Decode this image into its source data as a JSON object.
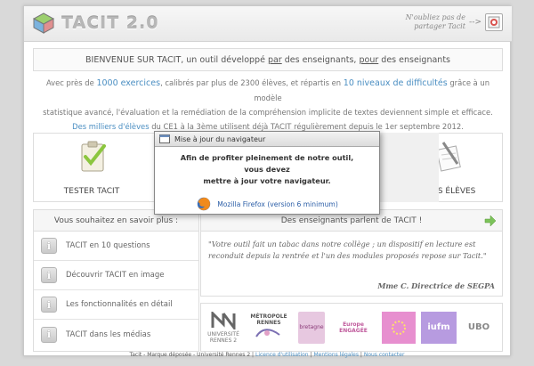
{
  "header": {
    "logo_text": "TACIT 2.0",
    "share_text_line1": "N'oubliez pas de",
    "share_text_line2": "partager Tacit",
    "share_arrow": "-->"
  },
  "welcome": {
    "part1": "BIENVENUE SUR TACIT, un outil développé ",
    "par": "par",
    "part2": " des enseignants, ",
    "pour": "pour",
    "part3": " des enseignants"
  },
  "intro": {
    "l1a": "Avec près de ",
    "l1b": "1000 exercices",
    "l1c": ", calibrés par plus de 2300 élèves, et répartis en ",
    "l1d": "10 niveaux de difficultés",
    "l1e": " grâce à un modèle",
    "l2": "statistique avancé, l'évaluation et la remédiation de la compréhension implicite de textes deviennent simple et efficace.",
    "l3a": "Des milliers d'élèves",
    "l3b": " du CE1 à la 3ème utilisent déjà TACIT régulièrement depuis le 1er septembre 2012."
  },
  "boxes": {
    "tester": "TESTER TACIT",
    "eleves": "ACCÈS ÉLÈVES"
  },
  "left_panel": {
    "title": "Vous souhaitez en savoir plus :",
    "items": [
      {
        "label": "TACIT en 10 questions"
      },
      {
        "label": "Découvrir TACIT en image"
      },
      {
        "label": "Les fonctionnalités en détail"
      },
      {
        "label": "TACIT dans les médias"
      }
    ]
  },
  "right_panel": {
    "title": "Des enseignants parlent de TACIT !",
    "quote": "\"Votre outil fait un tabac dans notre collège ; un dispositif en lecture est reconduit depuis la rentrée et l'un des modules proposés repose sur Tacit.\"",
    "author": "Mme C. Directrice de SEGPA"
  },
  "partners": {
    "p1": "UNIVERSITÉ RENNES 2",
    "p2": "MÉTROPOLE RENNES",
    "p3": "bretagne",
    "p4": "Europe ENGAGÉE",
    "p5": "",
    "p6": "iufm",
    "p7": "UBO"
  },
  "footer": {
    "prefix": "Tacit - Marque déposée - Université Rennes 2 | ",
    "licence": "Licence d'utilisation",
    "sep1": " | ",
    "mentions": "Mentions légales",
    "sep2": " | ",
    "contact": "Nous contacter"
  },
  "modal": {
    "title": "Mise à jour du navigateur",
    "line1": "Afin de profiter pleinement de notre outil, vous devez",
    "line2": "mettre à jour votre navigateur.",
    "link": "Mozilla Firefox (version 6 minimum)"
  },
  "colors": {
    "accent": "#4a8ec2",
    "arrow_green": "#7cc35a"
  }
}
